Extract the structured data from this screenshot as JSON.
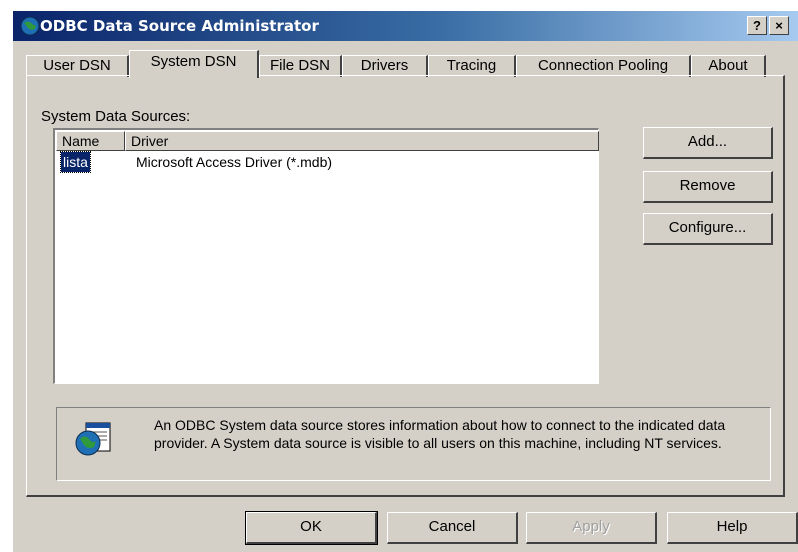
{
  "window": {
    "title": "ODBC Data Source Administrator",
    "help_glyph": "?",
    "close_glyph": "×"
  },
  "tabs": [
    {
      "label": "User DSN"
    },
    {
      "label": "System DSN"
    },
    {
      "label": "File DSN"
    },
    {
      "label": "Drivers"
    },
    {
      "label": "Tracing"
    },
    {
      "label": "Connection Pooling"
    },
    {
      "label": "About"
    }
  ],
  "active_tab": "System DSN",
  "panel": {
    "group_label": "System Data Sources:",
    "columns": [
      "Name",
      "Driver"
    ],
    "rows": [
      {
        "name": "lista",
        "driver": "Microsoft Access Driver (*.mdb)"
      }
    ],
    "buttons": {
      "add": "Add...",
      "remove": "Remove",
      "configure": "Configure..."
    },
    "info_text": "An ODBC System data source stores information about how to connect to the indicated data provider.   A System data source is visible to all users on this machine, including NT services."
  },
  "footer": {
    "ok": "OK",
    "cancel": "Cancel",
    "apply": "Apply",
    "help": "Help"
  },
  "colors": {
    "titlebar_start": "#0a246a",
    "titlebar_end": "#a6caf0",
    "face": "#d4d0c8",
    "selection": "#0a246a"
  },
  "icons": {
    "app": "odbc-globe-icon",
    "info": "data-source-icon"
  }
}
